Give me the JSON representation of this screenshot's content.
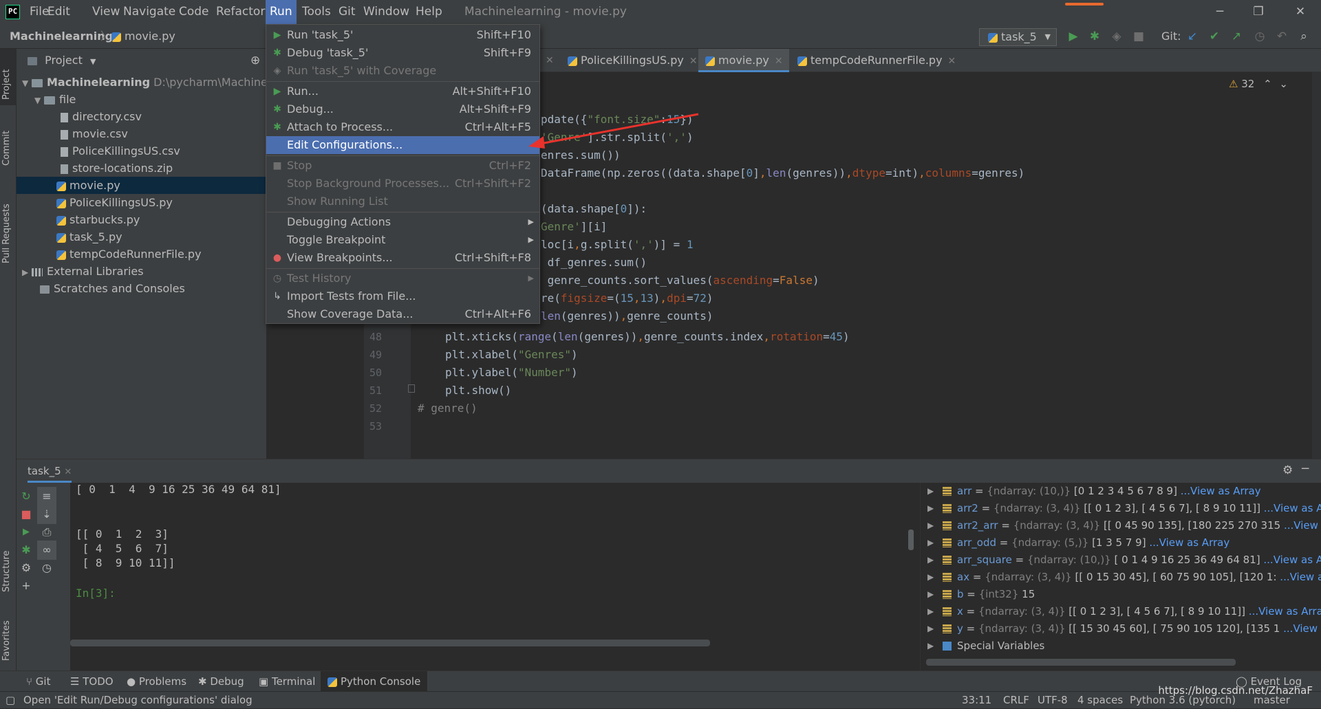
{
  "menubar": {
    "items": [
      "File",
      "Edit",
      "View",
      "Navigate",
      "Code",
      "Refactor",
      "Run",
      "Tools",
      "Git",
      "Window",
      "Help"
    ],
    "window_title": "Machinelearning - movie.py"
  },
  "navbar": {
    "project": "Machinelearning",
    "file": "movie.py",
    "run_config": "task_5",
    "git_label": "Git:"
  },
  "run_menu": {
    "items": [
      {
        "label": "Run 'task_5'",
        "shortcut": "Shift+F10",
        "icon": "run-icon",
        "state": "enabled"
      },
      {
        "label": "Debug 'task_5'",
        "shortcut": "Shift+F9",
        "icon": "debug-icon",
        "state": "enabled"
      },
      {
        "label": "Run 'task_5' with Coverage",
        "shortcut": "",
        "icon": "coverage-icon",
        "state": "disabled"
      },
      {
        "label": "Run...",
        "shortcut": "Alt+Shift+F10",
        "icon": "run-icon",
        "state": "enabled"
      },
      {
        "label": "Debug...",
        "shortcut": "Alt+Shift+F9",
        "icon": "debug-icon",
        "state": "enabled"
      },
      {
        "label": "Attach to Process...",
        "shortcut": "Ctrl+Alt+F5",
        "icon": "attach-icon",
        "state": "enabled"
      },
      {
        "label": "Edit Configurations...",
        "shortcut": "",
        "icon": "",
        "state": "highlighted"
      },
      {
        "label": "Stop",
        "shortcut": "Ctrl+F2",
        "icon": "stop-icon",
        "state": "disabled"
      },
      {
        "label": "Stop Background Processes...",
        "shortcut": "Ctrl+Shift+F2",
        "icon": "",
        "state": "disabled"
      },
      {
        "label": "Show Running List",
        "shortcut": "",
        "icon": "",
        "state": "disabled"
      },
      {
        "label": "Debugging Actions",
        "shortcut": "",
        "icon": "",
        "state": "submenu"
      },
      {
        "label": "Toggle Breakpoint",
        "shortcut": "",
        "icon": "",
        "state": "submenu"
      },
      {
        "label": "View Breakpoints...",
        "shortcut": "Ctrl+Shift+F8",
        "icon": "breakpoint-icon",
        "state": "enabled"
      },
      {
        "label": "Test History",
        "shortcut": "",
        "icon": "history-icon",
        "state": "disabled-submenu"
      },
      {
        "label": "Import Tests from File...",
        "shortcut": "",
        "icon": "import-icon",
        "state": "enabled"
      },
      {
        "label": "Show Coverage Data...",
        "shortcut": "Ctrl+Alt+F6",
        "icon": "",
        "state": "enabled"
      }
    ]
  },
  "project_panel": {
    "header": "Project",
    "root": "Machinelearning",
    "root_path": "D:\\pycharm\\Machinelea",
    "items": [
      {
        "label": "file",
        "type": "folder",
        "depth": 1
      },
      {
        "label": "directory.csv",
        "type": "file",
        "depth": 2
      },
      {
        "label": "movie.csv",
        "type": "file",
        "depth": 2
      },
      {
        "label": "PoliceKillingsUS.csv",
        "type": "file",
        "depth": 2
      },
      {
        "label": "store-locations.zip",
        "type": "file",
        "depth": 2
      },
      {
        "label": "movie.py",
        "type": "py",
        "depth": 1,
        "selected": true
      },
      {
        "label": "PoliceKillingsUS.py",
        "type": "py",
        "depth": 1
      },
      {
        "label": "starbucks.py",
        "type": "py",
        "depth": 1
      },
      {
        "label": "task_5.py",
        "type": "py",
        "depth": 1
      },
      {
        "label": "tempCodeRunnerFile.py",
        "type": "py",
        "depth": 1
      }
    ],
    "external": "External Libraries",
    "scratches": "Scratches and Consoles"
  },
  "side_tabs": {
    "project": "Project",
    "commit": "Commit",
    "pull_requests": "Pull Requests",
    "structure": "Structure",
    "favorites": "Favorites"
  },
  "editor_tabs": [
    {
      "label": "PoliceKillingsUS.py",
      "active": false
    },
    {
      "label": "movie.py",
      "active": true
    },
    {
      "label": "tempCodeRunnerFile.py",
      "active": false
    }
  ],
  "editor": {
    "warnings": "32",
    "line_numbers": [
      "48",
      "49",
      "50",
      "51",
      "52",
      "53"
    ]
  },
  "bottom": {
    "run_tab": "task_5",
    "console_lines": [
      "[ 0  1  4  9 16 25 36 49 64 81]",
      "",
      "",
      "[[ 0  1  2  3]",
      " [ 4  5  6  7]",
      " [ 8  9 10 11]]",
      "",
      "In[3]:"
    ],
    "variables": [
      {
        "name": "arr",
        "type": "{ndarray: (10,)}",
        "value": "[0 1 2 3 4 5 6 7 8 9]",
        "link": "...View as Array"
      },
      {
        "name": "arr2",
        "type": "{ndarray: (3, 4)}",
        "value": "[[ 0  1  2  3], [ 4  5  6  7], [ 8  9 10 11]]",
        "link": "...View as Array"
      },
      {
        "name": "arr2_arr",
        "type": "{ndarray: (3, 4)}",
        "value": "[[  0  45  90 135], [180 225 270 315",
        "link": "...View as Array"
      },
      {
        "name": "arr_odd",
        "type": "{ndarray: (5,)}",
        "value": "[1 3 5 7 9]",
        "link": "...View as Array"
      },
      {
        "name": "arr_square",
        "type": "{ndarray: (10,)}",
        "value": "[ 0  1  4  9 16 25 36 49 64 81]",
        "link": "...View as Array"
      },
      {
        "name": "ax",
        "type": "{ndarray: (3, 4)}",
        "value": "[[  0  15  30  45], [ 60  75  90 105], [120 1:",
        "link": "...View as Array"
      },
      {
        "name": "b",
        "type": "{int32}",
        "value": "15",
        "link": ""
      },
      {
        "name": "x",
        "type": "{ndarray: (3, 4)}",
        "value": "[[ 0  1  2  3], [ 4  5  6  7], [ 8  9 10 11]]",
        "link": "...View as Array"
      },
      {
        "name": "y",
        "type": "{ndarray: (3, 4)}",
        "value": "[[ 15  30  45  60], [ 75  90 105 120], [135 1",
        "link": "...View as Array"
      }
    ],
    "special": "Special Variables"
  },
  "tool_tabs": [
    "Git",
    "TODO",
    "Problems",
    "Debug",
    "Terminal",
    "Python Console"
  ],
  "status": {
    "message": "Open 'Edit Run/Debug configurations' dialog",
    "event_log": "Event Log",
    "position": "33:11",
    "line_sep": "CRLF",
    "encoding": "UTF-8",
    "indent": "4 spaces",
    "interpreter": "Python 3.6 (pytorch)",
    "branch": "master",
    "watermark": "https://blog.csdn.net/ZhazhaF"
  }
}
